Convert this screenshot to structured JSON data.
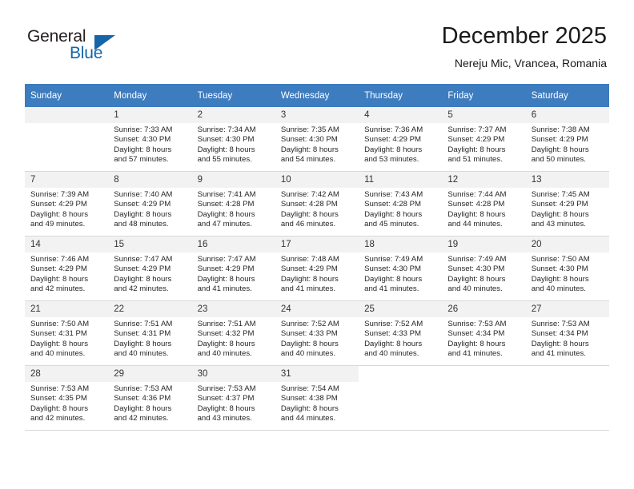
{
  "brand": {
    "name_part1": "General",
    "name_part2": "Blue",
    "logo_icon": "triangle-logo-icon",
    "accent_color": "#1565a8"
  },
  "header": {
    "month_title": "December 2025",
    "location": "Nereju Mic, Vrancea, Romania",
    "header_bg_color": "#3d7cbf"
  },
  "calendar": {
    "weekday_headers": [
      "Sunday",
      "Monday",
      "Tuesday",
      "Wednesday",
      "Thursday",
      "Friday",
      "Saturday"
    ],
    "weeks": [
      [
        {
          "day": "",
          "lines": []
        },
        {
          "day": "1",
          "lines": [
            "Sunrise: 7:33 AM",
            "Sunset: 4:30 PM",
            "Daylight: 8 hours",
            "and 57 minutes."
          ]
        },
        {
          "day": "2",
          "lines": [
            "Sunrise: 7:34 AM",
            "Sunset: 4:30 PM",
            "Daylight: 8 hours",
            "and 55 minutes."
          ]
        },
        {
          "day": "3",
          "lines": [
            "Sunrise: 7:35 AM",
            "Sunset: 4:30 PM",
            "Daylight: 8 hours",
            "and 54 minutes."
          ]
        },
        {
          "day": "4",
          "lines": [
            "Sunrise: 7:36 AM",
            "Sunset: 4:29 PM",
            "Daylight: 8 hours",
            "and 53 minutes."
          ]
        },
        {
          "day": "5",
          "lines": [
            "Sunrise: 7:37 AM",
            "Sunset: 4:29 PM",
            "Daylight: 8 hours",
            "and 51 minutes."
          ]
        },
        {
          "day": "6",
          "lines": [
            "Sunrise: 7:38 AM",
            "Sunset: 4:29 PM",
            "Daylight: 8 hours",
            "and 50 minutes."
          ]
        }
      ],
      [
        {
          "day": "7",
          "lines": [
            "Sunrise: 7:39 AM",
            "Sunset: 4:29 PM",
            "Daylight: 8 hours",
            "and 49 minutes."
          ]
        },
        {
          "day": "8",
          "lines": [
            "Sunrise: 7:40 AM",
            "Sunset: 4:29 PM",
            "Daylight: 8 hours",
            "and 48 minutes."
          ]
        },
        {
          "day": "9",
          "lines": [
            "Sunrise: 7:41 AM",
            "Sunset: 4:28 PM",
            "Daylight: 8 hours",
            "and 47 minutes."
          ]
        },
        {
          "day": "10",
          "lines": [
            "Sunrise: 7:42 AM",
            "Sunset: 4:28 PM",
            "Daylight: 8 hours",
            "and 46 minutes."
          ]
        },
        {
          "day": "11",
          "lines": [
            "Sunrise: 7:43 AM",
            "Sunset: 4:28 PM",
            "Daylight: 8 hours",
            "and 45 minutes."
          ]
        },
        {
          "day": "12",
          "lines": [
            "Sunrise: 7:44 AM",
            "Sunset: 4:28 PM",
            "Daylight: 8 hours",
            "and 44 minutes."
          ]
        },
        {
          "day": "13",
          "lines": [
            "Sunrise: 7:45 AM",
            "Sunset: 4:29 PM",
            "Daylight: 8 hours",
            "and 43 minutes."
          ]
        }
      ],
      [
        {
          "day": "14",
          "lines": [
            "Sunrise: 7:46 AM",
            "Sunset: 4:29 PM",
            "Daylight: 8 hours",
            "and 42 minutes."
          ]
        },
        {
          "day": "15",
          "lines": [
            "Sunrise: 7:47 AM",
            "Sunset: 4:29 PM",
            "Daylight: 8 hours",
            "and 42 minutes."
          ]
        },
        {
          "day": "16",
          "lines": [
            "Sunrise: 7:47 AM",
            "Sunset: 4:29 PM",
            "Daylight: 8 hours",
            "and 41 minutes."
          ]
        },
        {
          "day": "17",
          "lines": [
            "Sunrise: 7:48 AM",
            "Sunset: 4:29 PM",
            "Daylight: 8 hours",
            "and 41 minutes."
          ]
        },
        {
          "day": "18",
          "lines": [
            "Sunrise: 7:49 AM",
            "Sunset: 4:30 PM",
            "Daylight: 8 hours",
            "and 41 minutes."
          ]
        },
        {
          "day": "19",
          "lines": [
            "Sunrise: 7:49 AM",
            "Sunset: 4:30 PM",
            "Daylight: 8 hours",
            "and 40 minutes."
          ]
        },
        {
          "day": "20",
          "lines": [
            "Sunrise: 7:50 AM",
            "Sunset: 4:30 PM",
            "Daylight: 8 hours",
            "and 40 minutes."
          ]
        }
      ],
      [
        {
          "day": "21",
          "lines": [
            "Sunrise: 7:50 AM",
            "Sunset: 4:31 PM",
            "Daylight: 8 hours",
            "and 40 minutes."
          ]
        },
        {
          "day": "22",
          "lines": [
            "Sunrise: 7:51 AM",
            "Sunset: 4:31 PM",
            "Daylight: 8 hours",
            "and 40 minutes."
          ]
        },
        {
          "day": "23",
          "lines": [
            "Sunrise: 7:51 AM",
            "Sunset: 4:32 PM",
            "Daylight: 8 hours",
            "and 40 minutes."
          ]
        },
        {
          "day": "24",
          "lines": [
            "Sunrise: 7:52 AM",
            "Sunset: 4:33 PM",
            "Daylight: 8 hours",
            "and 40 minutes."
          ]
        },
        {
          "day": "25",
          "lines": [
            "Sunrise: 7:52 AM",
            "Sunset: 4:33 PM",
            "Daylight: 8 hours",
            "and 40 minutes."
          ]
        },
        {
          "day": "26",
          "lines": [
            "Sunrise: 7:53 AM",
            "Sunset: 4:34 PM",
            "Daylight: 8 hours",
            "and 41 minutes."
          ]
        },
        {
          "day": "27",
          "lines": [
            "Sunrise: 7:53 AM",
            "Sunset: 4:34 PM",
            "Daylight: 8 hours",
            "and 41 minutes."
          ]
        }
      ],
      [
        {
          "day": "28",
          "lines": [
            "Sunrise: 7:53 AM",
            "Sunset: 4:35 PM",
            "Daylight: 8 hours",
            "and 42 minutes."
          ]
        },
        {
          "day": "29",
          "lines": [
            "Sunrise: 7:53 AM",
            "Sunset: 4:36 PM",
            "Daylight: 8 hours",
            "and 42 minutes."
          ]
        },
        {
          "day": "30",
          "lines": [
            "Sunrise: 7:53 AM",
            "Sunset: 4:37 PM",
            "Daylight: 8 hours",
            "and 43 minutes."
          ]
        },
        {
          "day": "31",
          "lines": [
            "Sunrise: 7:54 AM",
            "Sunset: 4:38 PM",
            "Daylight: 8 hours",
            "and 44 minutes."
          ]
        },
        {
          "day": "",
          "lines": [],
          "blank": true
        },
        {
          "day": "",
          "lines": [],
          "blank": true
        },
        {
          "day": "",
          "lines": [],
          "blank": true
        }
      ]
    ]
  }
}
